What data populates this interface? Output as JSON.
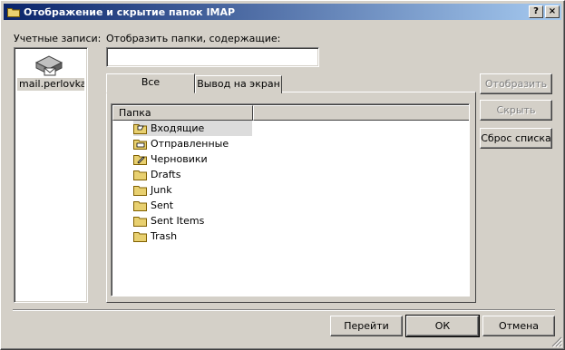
{
  "window": {
    "title": "Отображение и скрытие папок IMAP",
    "help_btn": "?",
    "close_btn": "×"
  },
  "accounts": {
    "label": "Учетные записи:",
    "items": [
      {
        "name": "mail.perlovka..."
      }
    ]
  },
  "search": {
    "label": "Отобразить папки, содержащие:",
    "value": "",
    "placeholder": ""
  },
  "tabs": [
    {
      "label": "Все",
      "active": true
    },
    {
      "label": "Вывод на экран",
      "active": false
    }
  ],
  "folder_list": {
    "column_header": "Папка",
    "folders": [
      {
        "name": "Входящие",
        "selected": true
      },
      {
        "name": "Отправленные",
        "selected": false
      },
      {
        "name": "Черновики",
        "selected": false
      },
      {
        "name": "Drafts",
        "selected": false
      },
      {
        "name": "Junk",
        "selected": false
      },
      {
        "name": "Sent",
        "selected": false
      },
      {
        "name": "Sent Items",
        "selected": false
      },
      {
        "name": "Trash",
        "selected": false
      }
    ]
  },
  "side_buttons": {
    "show": "Отобразить",
    "hide": "Скрыть",
    "reset": "Сброс списка"
  },
  "footer_buttons": {
    "goto": "Перейти",
    "ok": "ОК",
    "cancel": "Отмена"
  },
  "colors": {
    "title_start": "#0a246a",
    "title_end": "#a6caf0",
    "face": "#d4d0c8",
    "folder": "#e8d070"
  }
}
